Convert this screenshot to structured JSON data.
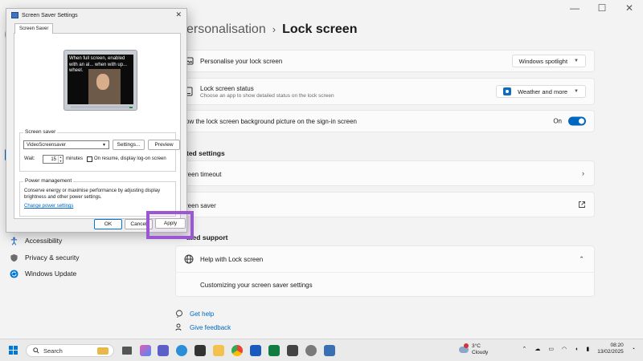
{
  "settings": {
    "breadcrumb": {
      "parent": "ersonalisation",
      "separator": "›",
      "current": "Lock screen"
    },
    "cards": [
      {
        "title": "Personalise your lock screen",
        "value": "Windows spotlight"
      },
      {
        "title": "Lock screen status",
        "subtitle": "Choose an app to show detailed status on the lock screen",
        "value": "Weather and more"
      },
      {
        "title": "ow the lock screen background picture on the sign-in screen",
        "toggle_label": "On"
      }
    ],
    "related_heading": "ted settings",
    "related": [
      {
        "title": "reen timeout"
      },
      {
        "title": "reen saver"
      }
    ],
    "support_heading": "ated support",
    "support": {
      "title": "Help with Lock screen",
      "link": "Customizing your screen saver settings"
    },
    "bottom_links": [
      "Get help",
      "Give feedback"
    ]
  },
  "sidebar": {
    "items": [
      {
        "label": "Accessibility",
        "icon": "accessibility-icon"
      },
      {
        "label": "Privacy & security",
        "icon": "shield-icon"
      },
      {
        "label": "Windows Update",
        "icon": "update-icon"
      }
    ]
  },
  "dialog": {
    "title": "Screen Saver Settings",
    "tab": "Screen Saver",
    "preview_text": "When full screen, enabled with an al... when with up... wheel.",
    "screen_saver_group": "Screen saver",
    "selected_saver": "VideoScreensaver",
    "settings_btn": "Settings...",
    "preview_btn": "Preview",
    "wait_label": "Wait:",
    "wait_value": "15",
    "minutes_label": "minutes",
    "resume_label": "On resume, display log-on screen",
    "power_group": "Power management",
    "power_text": "Conserve energy or maximise performance by adjusting display brightness and other power settings.",
    "power_link": "Change power settings",
    "ok": "OK",
    "cancel": "Cancel",
    "apply": "Apply"
  },
  "taskbar": {
    "search_placeholder": "Search",
    "weather_temp": "3°C",
    "weather_desc": "Cloudy",
    "time": "08:20",
    "date": "13/02/2025"
  },
  "colors": {
    "accent": "#0067c0",
    "highlight": "#9b57d3"
  }
}
